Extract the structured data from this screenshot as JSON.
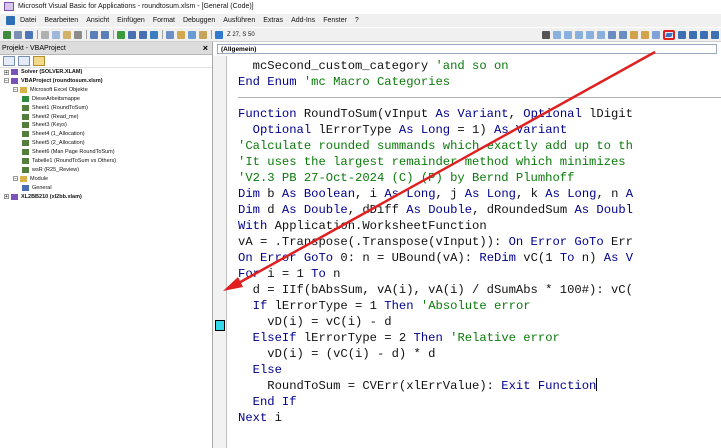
{
  "window": {
    "title": "Microsoft Visual Basic for Applications - roundtosum.xlsm - [General (Code)]"
  },
  "menu": {
    "items": [
      "Datei",
      "Bearbeiten",
      "Ansicht",
      "Einfügen",
      "Format",
      "Debuggen",
      "Ausführen",
      "Extras",
      "Add-Ins",
      "Fenster",
      "?"
    ]
  },
  "toolbar": {
    "position_readout": "Z 27, S 50",
    "highlighted_button_icon": "indent-icon"
  },
  "project_panel": {
    "title": "Projekt - VBAProject",
    "close": "×",
    "tree": [
      {
        "label": "Solver (SOLVER.XLAM)",
        "bold": true,
        "level": 0,
        "icon": "vba-project-icon",
        "expander": "+"
      },
      {
        "label": "VBAProject (roundtosum.xlsm)",
        "bold": true,
        "level": 0,
        "icon": "vba-project-icon",
        "expander": "−"
      },
      {
        "label": "Microsoft Excel Objekte",
        "bold": false,
        "level": 1,
        "icon": "folder-icon",
        "expander": "−"
      },
      {
        "label": "DieseArbeitsmappe",
        "bold": false,
        "level": 2,
        "icon": "workbook-icon"
      },
      {
        "label": "Sheet1 (RoundToSum)",
        "bold": false,
        "level": 2,
        "icon": "sheet-icon"
      },
      {
        "label": "Sheet2 (Read_me)",
        "bold": false,
        "level": 2,
        "icon": "sheet-icon"
      },
      {
        "label": "Sheet3 (Keys)",
        "bold": false,
        "level": 2,
        "icon": "sheet-icon"
      },
      {
        "label": "Sheet4 (1_Allocation)",
        "bold": false,
        "level": 2,
        "icon": "sheet-icon"
      },
      {
        "label": "Sheet5 (2_Allocation)",
        "bold": false,
        "level": 2,
        "icon": "sheet-icon"
      },
      {
        "label": "Sheet6 (Man Page RoundToSum)",
        "bold": false,
        "level": 2,
        "icon": "sheet-icon"
      },
      {
        "label": "Tabelle1 (RoundToSum vs Others)",
        "bold": false,
        "level": 2,
        "icon": "sheet-icon"
      },
      {
        "label": "wsR (R25_Review)",
        "bold": false,
        "level": 2,
        "icon": "sheet-icon"
      },
      {
        "label": "Module",
        "bold": false,
        "level": 1,
        "icon": "folder-icon",
        "expander": "−"
      },
      {
        "label": "General",
        "bold": false,
        "level": 2,
        "icon": "module-icon"
      },
      {
        "label": "XL2BB210 (xl2bb.xlam)",
        "bold": true,
        "level": 0,
        "icon": "vba-project-icon",
        "expander": "+"
      }
    ]
  },
  "editor": {
    "procedure_combo": "(Allgemein)",
    "code_lines": [
      [
        {
          "t": "  mcSecond_custom_category ",
          "c": "tx"
        },
        {
          "t": "'and so on",
          "c": "cm"
        }
      ],
      [
        {
          "t": "End Enum ",
          "c": "kw"
        },
        {
          "t": "'mc Macro Categories",
          "c": "cm"
        }
      ],
      [],
      [
        {
          "t": "Function ",
          "c": "kw"
        },
        {
          "t": "RoundToSum(vInput ",
          "c": "tx"
        },
        {
          "t": "As Variant",
          "c": "kw"
        },
        {
          "t": ", ",
          "c": "tx"
        },
        {
          "t": "Optional ",
          "c": "kw"
        },
        {
          "t": "lDigit",
          "c": "tx"
        }
      ],
      [
        {
          "t": "  Optional ",
          "c": "kw"
        },
        {
          "t": "lErrorType ",
          "c": "tx"
        },
        {
          "t": "As Long",
          "c": "kw"
        },
        {
          "t": " = 1) ",
          "c": "tx"
        },
        {
          "t": "As Variant",
          "c": "kw"
        }
      ],
      [
        {
          "t": "'Calculate rounded summands which exactly add up to th",
          "c": "cm"
        }
      ],
      [
        {
          "t": "'It uses the largest remainder method which minimizes",
          "c": "cm"
        }
      ],
      [
        {
          "t": "'V2.3 PB 27-Oct-2024 (C) (P) by Bernd Plumhoff",
          "c": "cm"
        }
      ],
      [
        {
          "t": "Dim ",
          "c": "kw"
        },
        {
          "t": "b ",
          "c": "tx"
        },
        {
          "t": "As Boolean",
          "c": "kw"
        },
        {
          "t": ", i ",
          "c": "tx"
        },
        {
          "t": "As Long",
          "c": "kw"
        },
        {
          "t": ", j ",
          "c": "tx"
        },
        {
          "t": "As Long",
          "c": "kw"
        },
        {
          "t": ", k ",
          "c": "tx"
        },
        {
          "t": "As Long",
          "c": "kw"
        },
        {
          "t": ", n ",
          "c": "tx"
        },
        {
          "t": "A",
          "c": "kw"
        }
      ],
      [
        {
          "t": "Dim ",
          "c": "kw"
        },
        {
          "t": "d ",
          "c": "tx"
        },
        {
          "t": "As Double",
          "c": "kw"
        },
        {
          "t": ", dDiff ",
          "c": "tx"
        },
        {
          "t": "As Double",
          "c": "kw"
        },
        {
          "t": ", dRoundedSum ",
          "c": "tx"
        },
        {
          "t": "As Doubl",
          "c": "kw"
        }
      ],
      [
        {
          "t": "With ",
          "c": "kw"
        },
        {
          "t": "Application.WorksheetFunction",
          "c": "tx"
        }
      ],
      [
        {
          "t": "vA = .Transpose(.Transpose(vInput)): ",
          "c": "tx"
        },
        {
          "t": "On Error GoTo ",
          "c": "kw"
        },
        {
          "t": "Err",
          "c": "tx"
        }
      ],
      [
        {
          "t": "On Error GoTo ",
          "c": "kw"
        },
        {
          "t": "0: n = UBound(vA): ",
          "c": "tx"
        },
        {
          "t": "ReDim ",
          "c": "kw"
        },
        {
          "t": "vC(1 ",
          "c": "tx"
        },
        {
          "t": "To ",
          "c": "kw"
        },
        {
          "t": "n) ",
          "c": "tx"
        },
        {
          "t": "As V",
          "c": "kw"
        }
      ],
      [
        {
          "t": "For ",
          "c": "kw"
        },
        {
          "t": "i = 1 ",
          "c": "tx"
        },
        {
          "t": "To ",
          "c": "kw"
        },
        {
          "t": "n",
          "c": "tx"
        }
      ],
      [
        {
          "t": "  d = IIf(bAbsSum, vA(i), vA(i) / dSumAbs * 100#): vC(",
          "c": "tx"
        }
      ],
      [
        {
          "t": "  If ",
          "c": "kw"
        },
        {
          "t": "lErrorType = 1 ",
          "c": "tx"
        },
        {
          "t": "Then ",
          "c": "kw"
        },
        {
          "t": "'Absolute error",
          "c": "cm"
        }
      ],
      [
        {
          "t": "    vD(i) = vC(i) - d",
          "c": "tx"
        }
      ],
      [
        {
          "t": "  ElseIf ",
          "c": "kw"
        },
        {
          "t": "lErrorType = 2 ",
          "c": "tx"
        },
        {
          "t": "Then ",
          "c": "kw"
        },
        {
          "t": "'Relative error",
          "c": "cm"
        }
      ],
      [
        {
          "t": "    vD(i) = (vC(i) - d) * d",
          "c": "tx"
        }
      ],
      [
        {
          "t": "  Else",
          "c": "kw"
        }
      ],
      [
        {
          "t": "    RoundToSum = CVErr(xlErrValue): ",
          "c": "tx"
        },
        {
          "t": "Exit Function",
          "c": "kw"
        }
      ],
      [
        {
          "t": "  End If",
          "c": "kw"
        }
      ],
      [
        {
          "t": "Next ",
          "c": "kw"
        },
        {
          "t": "i",
          "c": "tx"
        }
      ]
    ]
  },
  "colors": {
    "keyword": "#00008b",
    "comment": "#0a7a0a",
    "annotation_red": "#e02020",
    "margin_marker": "#33d9e8"
  }
}
